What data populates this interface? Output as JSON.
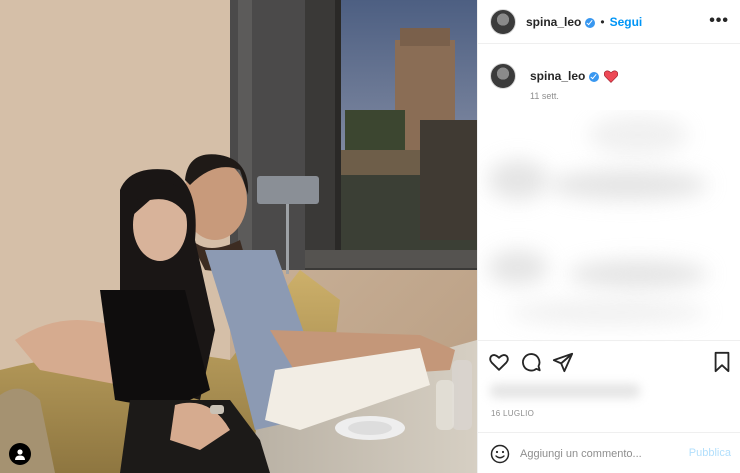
{
  "post": {
    "username": "spina_leo",
    "verified": true,
    "separator": "•",
    "follow_label": "Segui",
    "more_icon": "more-dots-icon",
    "more_label": "•••"
  },
  "caption": {
    "username": "spina_leo",
    "emoji": "red-heart",
    "date": "11 sett."
  },
  "actions": {
    "like_icon": "heart-outline-icon",
    "comment_icon": "comment-bubble-icon",
    "share_icon": "paper-plane-icon",
    "save_icon": "bookmark-icon"
  },
  "post_date": "16 LUGLIO",
  "comment": {
    "placeholder": "Aggiungi un commento...",
    "publish_label": "Pubblica",
    "emoji_icon": "smiley-icon"
  },
  "colors": {
    "link_blue": "#0095f6",
    "publish_disabled": "#b2dffc",
    "verified_blue": "#3897f0",
    "heart_red": "#ed4956",
    "muted_text": "#8e8e8e"
  }
}
